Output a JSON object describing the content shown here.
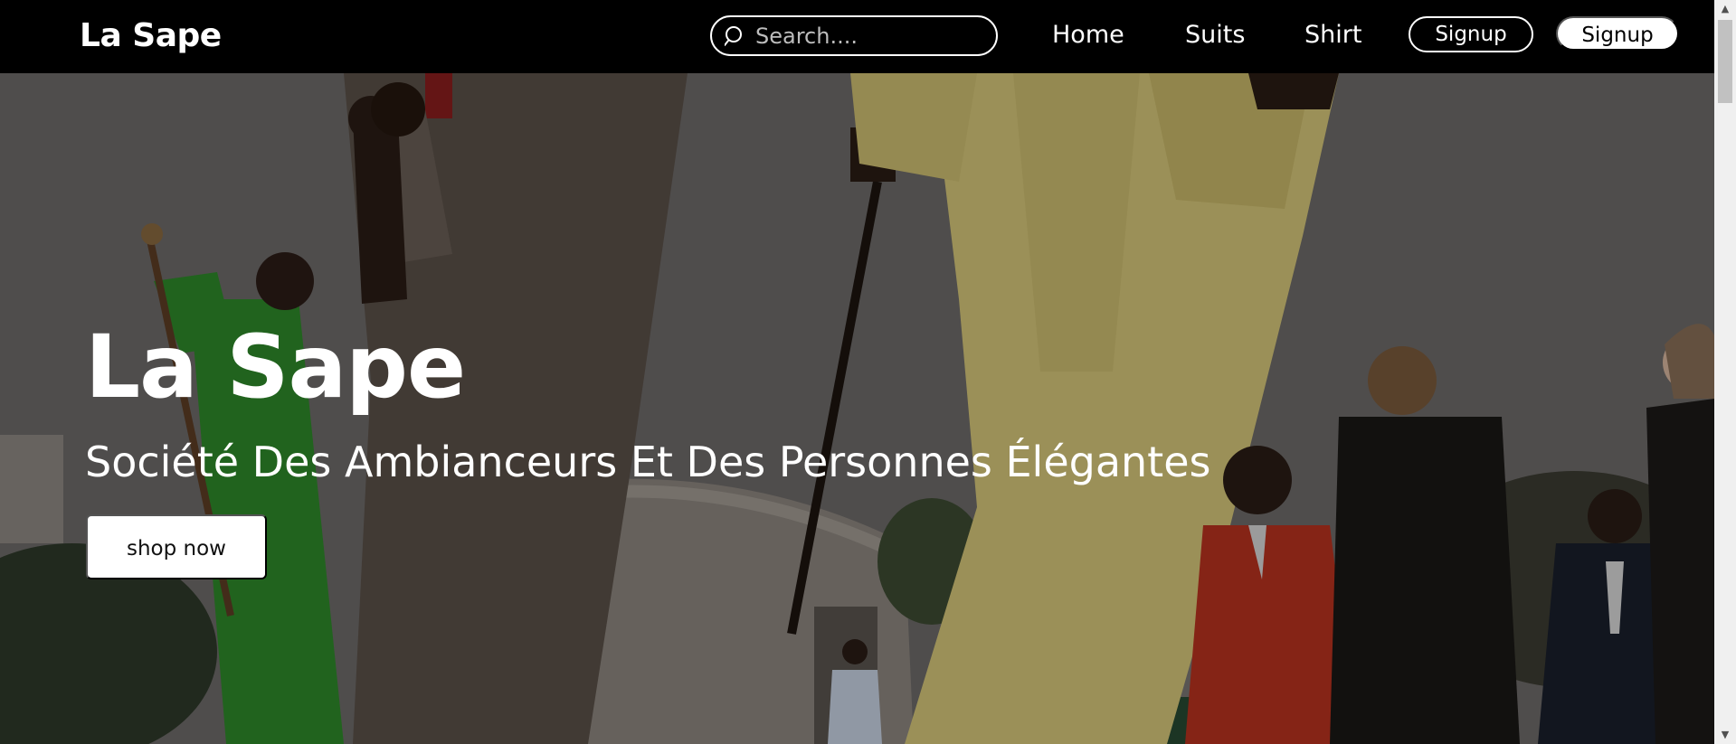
{
  "navbar": {
    "brand": "La Sape",
    "search": {
      "placeholder": "Search...."
    },
    "links": {
      "home": "Home",
      "suits": "Suits",
      "shirt": "Shirt"
    },
    "signup_outline": "Signup",
    "signup_filled": "Signup"
  },
  "hero": {
    "title": "La Sape",
    "subtitle": "Société Des Ambianceurs Et Des Personnes Élégantes",
    "cta": "shop now"
  },
  "colors": {
    "navbar_bg": "#000000",
    "text": "#ffffff"
  },
  "icons": {
    "search": "search-icon",
    "scroll_up": "chevron-up-icon",
    "scroll_down": "chevron-down-icon"
  }
}
